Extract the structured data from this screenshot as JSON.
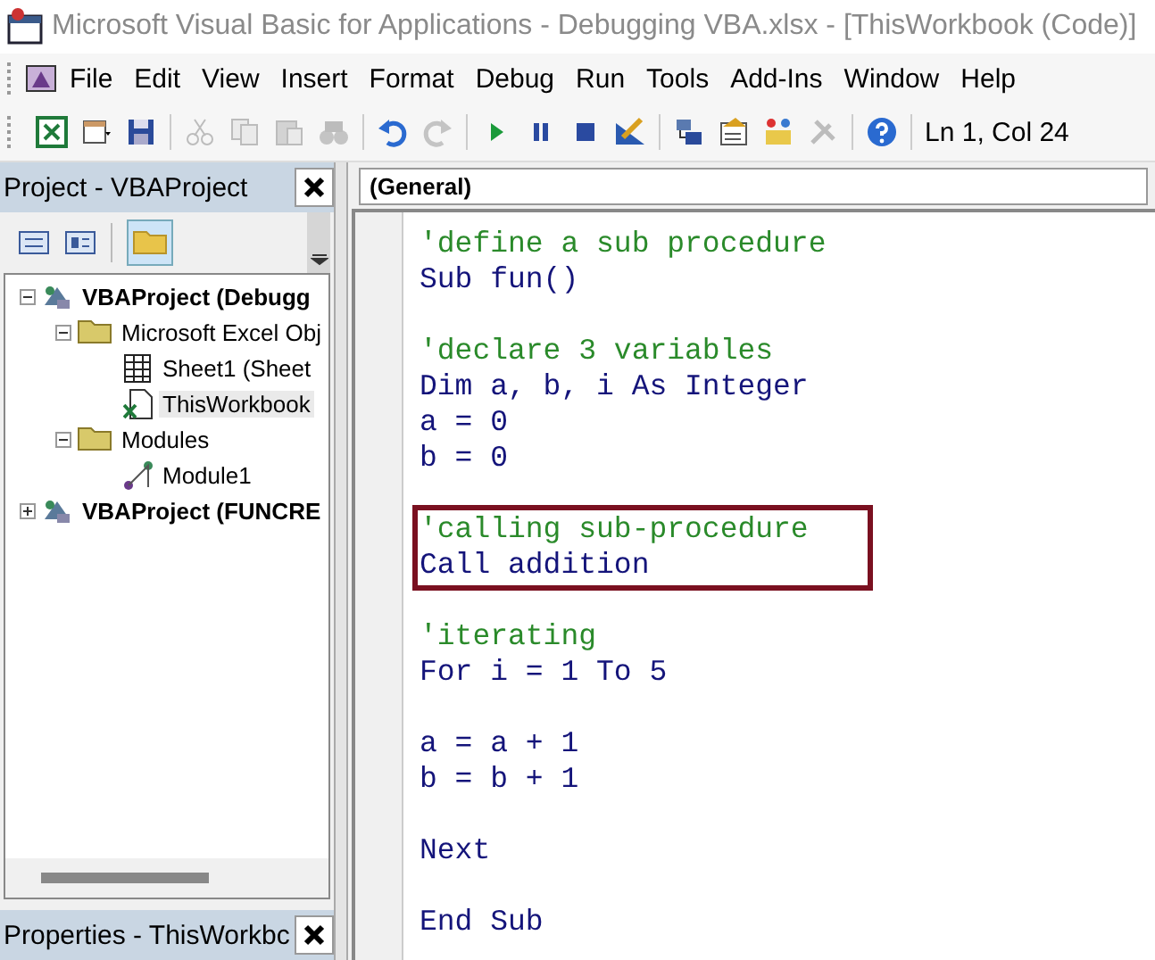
{
  "window": {
    "title": "Microsoft Visual Basic for Applications - Debugging VBA.xlsx - [ThisWorkbook (Code)]"
  },
  "menu": [
    "File",
    "Edit",
    "View",
    "Insert",
    "Format",
    "Debug",
    "Run",
    "Tools",
    "Add-Ins",
    "Window",
    "Help"
  ],
  "toolbar": [
    [
      {
        "kind": "excel",
        "disabled": false
      },
      {
        "kind": "insert-form",
        "disabled": false
      },
      {
        "kind": "save",
        "disabled": false
      }
    ],
    [
      {
        "kind": "cut",
        "disabled": true
      },
      {
        "kind": "copy",
        "disabled": true
      },
      {
        "kind": "paste",
        "disabled": true
      },
      {
        "kind": "find",
        "disabled": true
      }
    ],
    [
      {
        "kind": "undo",
        "disabled": false
      },
      {
        "kind": "redo",
        "disabled": true
      }
    ],
    [
      {
        "kind": "run",
        "disabled": false
      },
      {
        "kind": "pause",
        "disabled": false
      },
      {
        "kind": "stop",
        "disabled": false
      },
      {
        "kind": "design",
        "disabled": false
      }
    ],
    [
      {
        "kind": "explorer",
        "disabled": false
      },
      {
        "kind": "properties",
        "disabled": false
      },
      {
        "kind": "objects",
        "disabled": false
      },
      {
        "kind": "toolbox",
        "disabled": true
      }
    ],
    [
      {
        "kind": "help",
        "disabled": false
      }
    ]
  ],
  "cursor_position": "Ln 1, Col 24",
  "project_panel": {
    "title": "Project - VBAProject",
    "toggle_folders": {
      "selected": true
    },
    "tree": [
      {
        "label": "VBAProject (Debugg",
        "kind": "project",
        "expanded": true,
        "selected": false,
        "children": [
          {
            "label": "Microsoft Excel Obj",
            "kind": "folder",
            "expanded": true,
            "selected": false,
            "children": [
              {
                "label": "Sheet1 (Sheet",
                "kind": "sheet",
                "selected": false
              },
              {
                "label": "ThisWorkbook",
                "kind": "workbook",
                "selected": true
              }
            ]
          },
          {
            "label": "Modules",
            "kind": "folder",
            "expanded": true,
            "selected": false,
            "children": [
              {
                "label": "Module1",
                "kind": "module",
                "selected": false
              }
            ]
          }
        ]
      },
      {
        "label": "VBAProject (FUNCRE",
        "kind": "project",
        "expanded": false,
        "selected": false
      }
    ]
  },
  "properties_panel": {
    "title": "Properties - ThisWorkbc"
  },
  "code_window": {
    "object_dropdown": "(General)",
    "blocks": [
      {
        "highlighted": false,
        "lines": [
          {
            "kind": "comment",
            "text": "'define a sub procedure"
          },
          {
            "kind": "code",
            "text": "Sub fun()"
          },
          {
            "kind": "blank"
          },
          {
            "kind": "comment",
            "text": "'declare 3 variables"
          },
          {
            "kind": "code",
            "text": "Dim a, b, i As Integer"
          },
          {
            "kind": "code",
            "text": "a = 0"
          },
          {
            "kind": "code",
            "text": "b = 0"
          },
          {
            "kind": "blank"
          }
        ]
      },
      {
        "highlighted": true,
        "lines": [
          {
            "kind": "comment",
            "text": "'calling sub-procedure"
          },
          {
            "kind": "code",
            "text": "Call addition"
          }
        ]
      },
      {
        "highlighted": false,
        "lines": [
          {
            "kind": "blank"
          },
          {
            "kind": "comment",
            "text": "'iterating"
          },
          {
            "kind": "code",
            "text": "For i = 1 To 5"
          },
          {
            "kind": "blank"
          },
          {
            "kind": "code",
            "text": "a = a + 1"
          },
          {
            "kind": "code",
            "text": "b = b + 1"
          },
          {
            "kind": "blank"
          },
          {
            "kind": "code",
            "text": "Next"
          },
          {
            "kind": "blank"
          },
          {
            "kind": "code",
            "text": "End Sub"
          }
        ]
      }
    ]
  }
}
